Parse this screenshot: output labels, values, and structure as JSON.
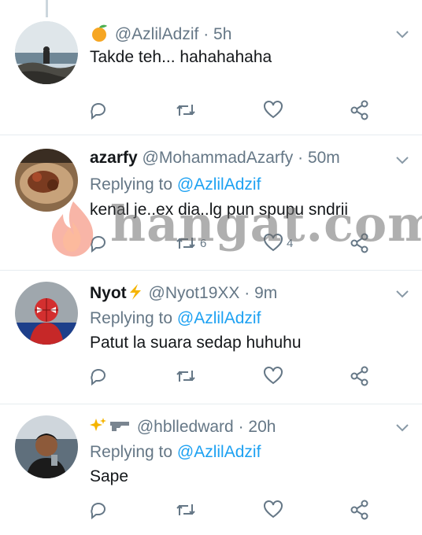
{
  "colors": {
    "accent": "#1da1f2",
    "muted": "#657786",
    "text": "#14171a",
    "divider": "#e6ecf0"
  },
  "tweets": [
    {
      "display_name": "",
      "handle": "@AzlilAdzif",
      "time": "5h",
      "replying_to_label": "",
      "replying_to_handle": "",
      "text": "Takde teh... hahahahaha",
      "reply_count": "",
      "retweet_count": "",
      "like_count": "",
      "name_emoji": "orange-icon"
    },
    {
      "display_name": "azarfy",
      "handle": "@MohammadAzarfy",
      "time": "50m",
      "replying_to_label": "Replying to",
      "replying_to_handle": "@AzlilAdzif",
      "text": "kenal je..ex dia..lg pun spupu sndrii",
      "reply_count": "",
      "retweet_count": "6",
      "like_count": "4",
      "name_emoji": ""
    },
    {
      "display_name": "Nyot",
      "handle": "@Nyot19XX",
      "time": "9m",
      "replying_to_label": "Replying to",
      "replying_to_handle": "@AzlilAdzif",
      "text": "Patut la suara sedap huhuhu",
      "reply_count": "",
      "retweet_count": "",
      "like_count": "",
      "name_emoji": "lightning-icon"
    },
    {
      "display_name": "",
      "handle": "@hblledward",
      "time": "20h",
      "replying_to_label": "Replying to",
      "replying_to_handle": "@AzlilAdzif",
      "text": "Sape",
      "reply_count": "",
      "retweet_count": "",
      "like_count": "",
      "name_emoji": "sparkles-gun-icon"
    }
  ],
  "watermark": {
    "text": "hangat.com"
  }
}
